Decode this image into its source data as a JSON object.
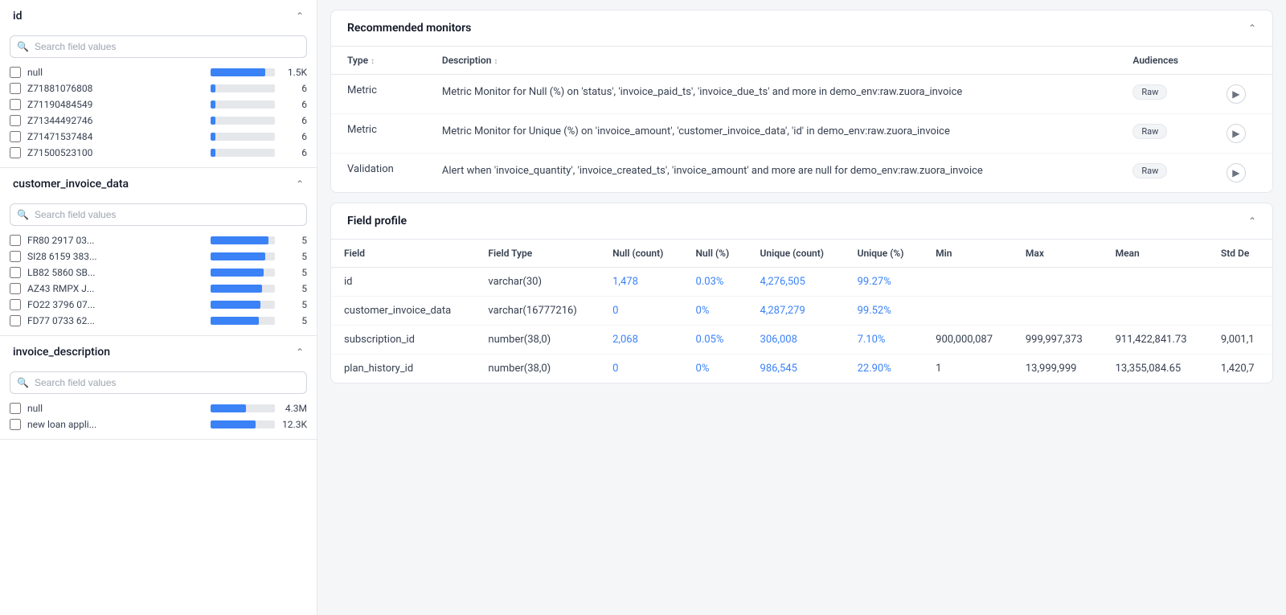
{
  "left": {
    "sections": [
      {
        "id": "id",
        "title": "id",
        "search_placeholder": "Search field values",
        "items": [
          {
            "label": "null",
            "bar_pct": 85,
            "count": "1.5K"
          },
          {
            "label": "Z71881076808",
            "bar_pct": 8,
            "count": "6"
          },
          {
            "label": "Z71190484549",
            "bar_pct": 8,
            "count": "6"
          },
          {
            "label": "Z71344492746",
            "bar_pct": 8,
            "count": "6"
          },
          {
            "label": "Z71471537484",
            "bar_pct": 8,
            "count": "6"
          },
          {
            "label": "Z71500523100",
            "bar_pct": 8,
            "count": "6"
          }
        ]
      },
      {
        "id": "customer_invoice_data",
        "title": "customer_invoice_data",
        "search_placeholder": "Search field values",
        "items": [
          {
            "label": "FR80 2917 03...",
            "bar_pct": 90,
            "count": "5"
          },
          {
            "label": "SI28 6159 383...",
            "bar_pct": 85,
            "count": "5"
          },
          {
            "label": "LB82 5860 SB...",
            "bar_pct": 82,
            "count": "5"
          },
          {
            "label": "AZ43 RMPX J...",
            "bar_pct": 80,
            "count": "5"
          },
          {
            "label": "FO22 3796 07...",
            "bar_pct": 78,
            "count": "5"
          },
          {
            "label": "FD77 0733 62...",
            "bar_pct": 75,
            "count": "5"
          }
        ]
      },
      {
        "id": "invoice_description",
        "title": "invoice_description",
        "search_placeholder": "Search field values",
        "items": [
          {
            "label": "null",
            "bar_pct": 55,
            "count": "4.3M"
          },
          {
            "label": "new loan appli...",
            "bar_pct": 70,
            "count": "12.3K"
          }
        ]
      }
    ]
  },
  "right": {
    "recommended_monitors": {
      "title": "Recommended monitors",
      "columns": [
        "Type",
        "Description",
        "Audiences"
      ],
      "rows": [
        {
          "type": "Metric",
          "description": "Metric Monitor for Null (%) on 'status', 'invoice_paid_ts', 'invoice_due_ts' and more in demo_env:raw.zuora_invoice",
          "audience": "Raw"
        },
        {
          "type": "Metric",
          "description": "Metric Monitor for Unique (%) on 'invoice_amount', 'customer_invoice_data', 'id' in demo_env:raw.zuora_invoice",
          "audience": "Raw"
        },
        {
          "type": "Validation",
          "description": "Alert when 'invoice_quantity', 'invoice_created_ts', 'invoice_amount' and more are null for demo_env:raw.zuora_invoice",
          "audience": "Raw"
        }
      ]
    },
    "field_profile": {
      "title": "Field profile",
      "columns": [
        "Field",
        "Field Type",
        "Null (count)",
        "Null (%)",
        "Unique (count)",
        "Unique (%)",
        "Min",
        "Max",
        "Mean",
        "Std De"
      ],
      "rows": [
        {
          "field": "id",
          "field_type": "varchar(30)",
          "null_count": "1,478",
          "null_pct": "0.03%",
          "unique_count": "4,276,505",
          "unique_pct": "99.27%",
          "min": "",
          "max": "",
          "mean": "",
          "std_dev": ""
        },
        {
          "field": "customer_invoice_data",
          "field_type": "varchar(16777216)",
          "null_count": "0",
          "null_pct": "0%",
          "unique_count": "4,287,279",
          "unique_pct": "99.52%",
          "min": "",
          "max": "",
          "mean": "",
          "std_dev": ""
        },
        {
          "field": "subscription_id",
          "field_type": "number(38,0)",
          "null_count": "2,068",
          "null_pct": "0.05%",
          "unique_count": "306,008",
          "unique_pct": "7.10%",
          "min": "900,000,087",
          "max": "999,997,373",
          "mean": "911,422,841.73",
          "std_dev": "9,001,1"
        },
        {
          "field": "plan_history_id",
          "field_type": "number(38,0)",
          "null_count": "0",
          "null_pct": "0%",
          "unique_count": "986,545",
          "unique_pct": "22.90%",
          "min": "1",
          "max": "13,999,999",
          "mean": "13,355,084.65",
          "std_dev": "1,420,7"
        }
      ]
    }
  }
}
